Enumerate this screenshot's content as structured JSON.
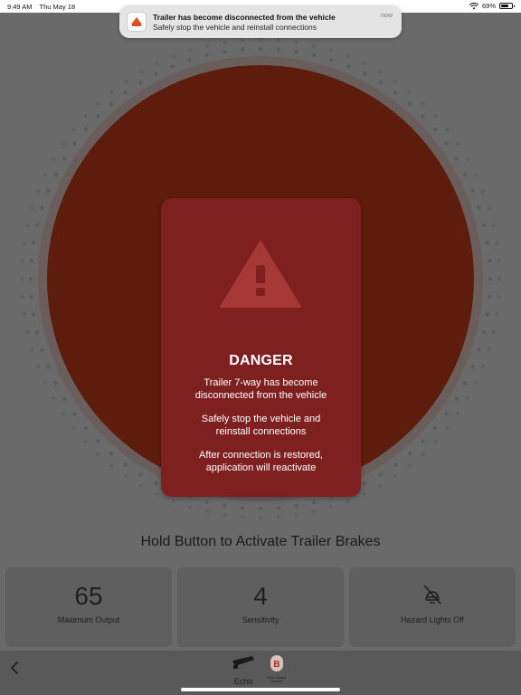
{
  "status_bar": {
    "time": "9:49 AM",
    "date": "Thu May 18",
    "battery": "69%",
    "battery_level": 0.69
  },
  "notification": {
    "app_icon": "brake-app-icon",
    "title": "Trailer has become disconnected from the vehicle",
    "body": "Safely stop the vehicle and reinstall connections",
    "time": "now"
  },
  "dial": {
    "color": "#5e1c0c",
    "ring_color": "#6d4640"
  },
  "danger": {
    "icon": "warning-triangle-icon",
    "title": "DANGER",
    "message_1_line_1": "Trailer 7-way has become",
    "message_1_line_2": "disconnected from the vehicle",
    "message_2_line_1": "Safely stop the vehicle and",
    "message_2_line_2": "reinstall connections",
    "message_3_line_1": "After connection is restored,",
    "message_3_line_2": "application will reactivate",
    "card_color": "#7f2020"
  },
  "prompt": "Hold Button to Activate Trailer Brakes",
  "stats": [
    {
      "value": "65",
      "label": "Maximum Output"
    },
    {
      "value": "4",
      "label": "Sensitivity"
    },
    {
      "icon": "hazard-lights-off-icon",
      "label": "Hazard Lights Off"
    }
  ],
  "tab_bar": {
    "back_icon": "chevron-left-icon",
    "echo_label": "Echo",
    "override_label_1": "Echo Manual",
    "override_label_2": "Override"
  }
}
